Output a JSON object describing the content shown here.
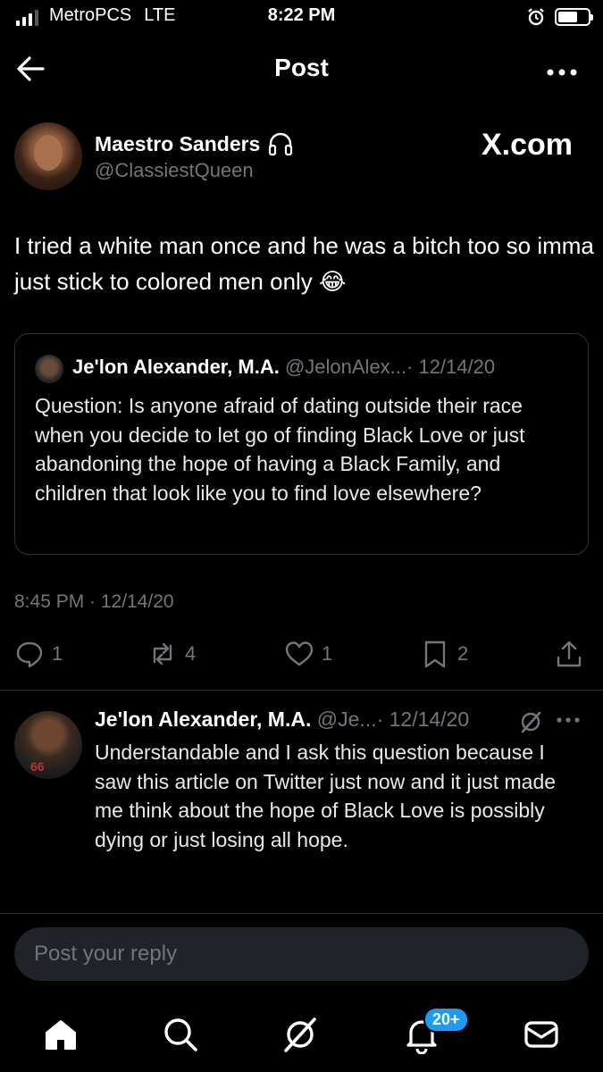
{
  "status_bar": {
    "carrier": "MetroPCS",
    "network": "LTE",
    "time": "8:22 PM",
    "battery_level": 0.7
  },
  "header": {
    "title": "Post",
    "back_icon": "arrow-left-icon",
    "more_icon": "more-horizontal-icon"
  },
  "post": {
    "author_name": "Maestro Sanders",
    "author_handle": "@ClassiestQueen",
    "watermark": "X.com",
    "text": "I tried a white man once and he was a bitch too so imma just stick to colored men only 😂",
    "quote": {
      "author_name": "Je'lon Alexander, M.A.",
      "author_handle": "@JelonAlex...",
      "date": "· 12/14/20",
      "text": "Question: Is anyone afraid of dating outside their race when you decide to let go of finding Black Love or just abandoning the hope of having a Black Family, and children that look like you to find love elsewhere?"
    },
    "timestamp": "8:45 PM · 12/14/20",
    "actions": {
      "replies": "1",
      "reposts": "4",
      "likes": "1",
      "bookmarks": "2"
    }
  },
  "reply": {
    "author_name": "Je'lon Alexander, M.A.",
    "author_handle": "@Je...",
    "date": "· 12/14/20",
    "jersey_text": "66",
    "text": "Understandable and I ask this question because I saw this article  on Twitter just now and it just made me think about the hope of Black Love is possibly dying or just losing all hope."
  },
  "composer": {
    "placeholder": "Post your reply"
  },
  "bottom_nav": {
    "items": [
      "home-icon",
      "search-icon",
      "grok-icon",
      "notifications-icon",
      "messages-icon"
    ],
    "notifications_badge": "20+"
  },
  "colors": {
    "background": "#000000",
    "muted": "#71767b",
    "border": "#2f3336",
    "accent": "#1d9bf0"
  }
}
